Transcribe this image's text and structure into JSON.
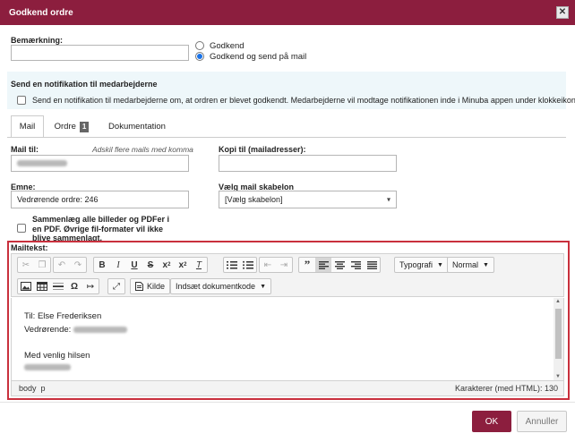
{
  "dialog": {
    "title": "Godkend ordre",
    "close": "✕"
  },
  "remark": {
    "label": "Bemærkning:",
    "value": "",
    "options": [
      {
        "label": "Godkend",
        "selected": false
      },
      {
        "label": "Godkend og send på mail",
        "selected": true
      }
    ]
  },
  "notification": {
    "heading": "Send en notifikation til medarbejderne",
    "checkbox_label": "Send en notifikation til medarbejderne om, at ordren er blevet godkendt. Medarbejderne vil modtage notifikationen inde i Minuba appen under klokkeikonet.",
    "checked": false
  },
  "tabs": [
    {
      "label": "Mail",
      "active": true
    },
    {
      "label": "Ordre",
      "badge": "1",
      "active": false
    },
    {
      "label": "Dokumentation",
      "active": false
    }
  ],
  "form": {
    "mail_to_label": "Mail til:",
    "mail_to_hint": "Adskil flere mails med komma",
    "mail_to_value": "",
    "cc_label": "Kopi til (mailadresser):",
    "cc_value": "",
    "subject_label": "Emne:",
    "subject_value": "Vedrørende ordre: 246",
    "template_label": "Vælg mail skabelon",
    "template_value": "[Vælg skabelon]",
    "merge_label": "Sammenlæg alle billeder og PDFer i en PDF. Øvrige fil-formater vil ikke blive sammenlagt.",
    "merge_checked": false
  },
  "editor": {
    "label": "Mailtekst:",
    "toolbar": {
      "typografi": "Typografi",
      "format": "Normal",
      "kilde": "Kilde",
      "insert_code": "Indsæt dokumentkode"
    },
    "content": {
      "line1": "Til: Else Frederiksen",
      "line2": "Vedrørende:",
      "line3": "Med venlig hilsen"
    },
    "statusbar": {
      "path": "body  p",
      "count": "Karakterer (med HTML): 130"
    }
  },
  "footer": {
    "ok": "OK",
    "cancel": "Annuller"
  },
  "colors": {
    "brand": "#8c1e3e",
    "highlight_border": "#c9303d",
    "radio_selected": "#1a73e8"
  }
}
